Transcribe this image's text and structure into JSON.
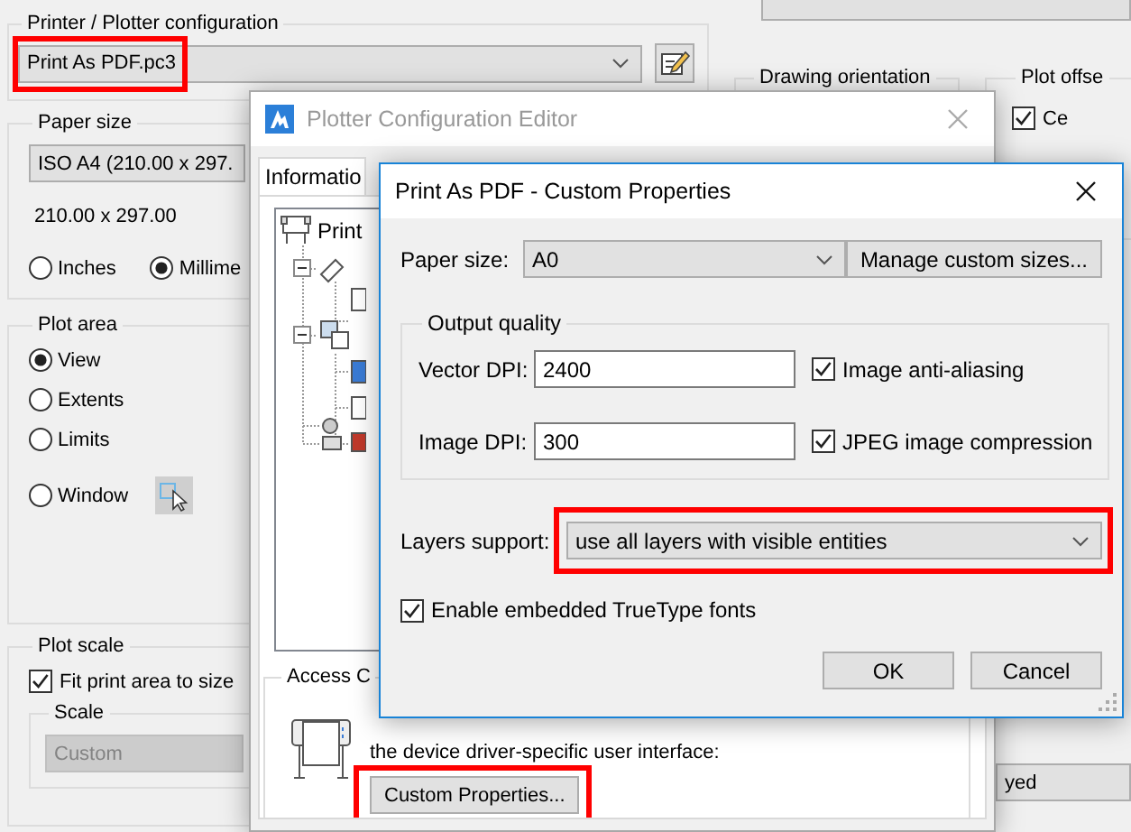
{
  "background_dialog": {
    "printer_group": {
      "title": "Printer / Plotter configuration",
      "printer": {
        "value": "Print As PDF.pc3",
        "highlighted": true
      }
    },
    "paper_size_group": {
      "title": "Paper size",
      "paper": {
        "value": "ISO A4 (210.00 x 297."
      },
      "dimensions": "210.00 x 297.00",
      "units": [
        {
          "label": "Inches",
          "selected": false
        },
        {
          "label": "Millime",
          "selected": true
        }
      ]
    },
    "plot_area_group": {
      "title": "Plot area",
      "options": [
        {
          "label": "View",
          "selected": true
        },
        {
          "label": "Extents",
          "selected": false
        },
        {
          "label": "Limits",
          "selected": false
        },
        {
          "label": "Window",
          "selected": false
        }
      ]
    },
    "plot_scale_group": {
      "title": "Plot scale",
      "fit": {
        "label": "Fit print area to size",
        "checked": true
      },
      "scale_group": {
        "title": "Scale",
        "combo": {
          "value": "Custom",
          "disabled": true
        }
      }
    },
    "orientation_group": {
      "title": "Drawing orientation"
    },
    "offset_group": {
      "title": "Plot offse",
      "center": {
        "label": "Ce",
        "checked": true
      }
    },
    "bottom_combo": {
      "value": "yed"
    }
  },
  "editor_window": {
    "title": "Plotter Configuration Editor",
    "active": false,
    "tabs": [
      {
        "label": "Informatio",
        "selected": true
      }
    ],
    "tree": [
      {
        "label": "Print"
      }
    ],
    "access_group": {
      "title": "Access C",
      "description": "the device driver-specific user interface:",
      "button": {
        "label": "Custom Properties...",
        "highlighted": true
      }
    }
  },
  "custom_properties_dialog": {
    "title": "Print As PDF - Custom Properties",
    "active": true,
    "paper_size": {
      "label": "Paper size:",
      "value": "A0"
    },
    "manage_button": {
      "label": "Manage custom sizes..."
    },
    "output_quality": {
      "title": "Output quality",
      "rows": [
        {
          "label": "Vector DPI:",
          "value": "2400",
          "option": {
            "label": "Image anti-aliasing",
            "checked": true
          }
        },
        {
          "label": "Image DPI:",
          "value": "300",
          "option": {
            "label": "JPEG image compression",
            "checked": true
          }
        }
      ]
    },
    "layers_support": {
      "label": "Layers support:",
      "value": "use all layers with visible entities",
      "highlighted": true
    },
    "embed_fonts": {
      "label": "Enable embedded TrueType fonts",
      "checked": true
    },
    "buttons": [
      {
        "label": "OK"
      },
      {
        "label": "Cancel"
      }
    ]
  }
}
